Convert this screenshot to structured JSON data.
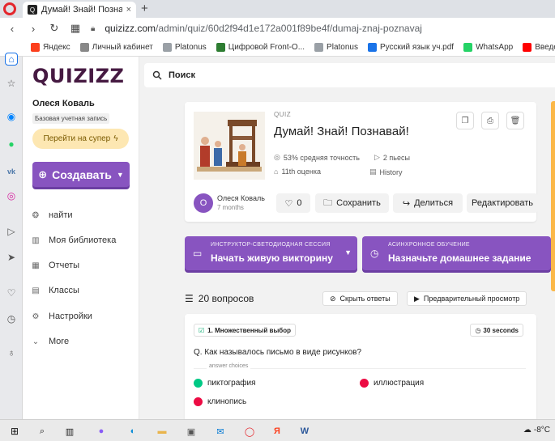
{
  "browser": {
    "tab_title": "Думай! Знай! Познавай! -",
    "tab_close": "×",
    "new_tab": "+",
    "url_host": "quizizz.com",
    "url_path": "/admin/quiz/60d2f94d1e172a001f89be4f/dumaj-znaj-poznavaj",
    "bookmarks": [
      {
        "label": "Яндекс",
        "color": "#fc3f1d"
      },
      {
        "label": "Личный кабинет",
        "color": "#888888"
      },
      {
        "label": "Platonus",
        "color": "#9aa0a6"
      },
      {
        "label": "Цифровой Front-O...",
        "color": "#2e7d32"
      },
      {
        "label": "Platonus",
        "color": "#9aa0a6"
      },
      {
        "label": "Русский язык уч.pdf",
        "color": "#1a73e8"
      },
      {
        "label": "WhatsApp",
        "color": "#25d366"
      },
      {
        "label": "Введение в языкоз...",
        "color": "#ff0000"
      }
    ]
  },
  "sidebar": {
    "logo": "QUIZIZZ",
    "user_name": "Олеся Коваль",
    "account_type": "Базовая учетная запись",
    "upgrade_label": "Перейти на супер",
    "create_label": "Создавать",
    "nav": [
      {
        "label": "найти",
        "icon": "compass-icon"
      },
      {
        "label": "Моя библиотека",
        "icon": "library-icon"
      },
      {
        "label": "Отчеты",
        "icon": "reports-icon"
      },
      {
        "label": "Классы",
        "icon": "classes-icon"
      },
      {
        "label": "Настройки",
        "icon": "settings-icon"
      },
      {
        "label": "More",
        "icon": "chevron-down-icon"
      }
    ]
  },
  "search": {
    "label": "Поиск"
  },
  "quiz": {
    "tag": "QUIZ",
    "title": "Думай! Знай! Познавай!",
    "accuracy": "53% средняя точность",
    "plays": "2 пьесы",
    "grade": "11th оценка",
    "subject": "History",
    "author": "Олеся Коваль",
    "author_initial": "О",
    "time_ago": "7 months",
    "likes": "0",
    "save_label": "Сохранить",
    "share_label": "Делиться",
    "edit_label": "Редактировать"
  },
  "actions": {
    "live_small": "ИНСТРУКТОР-СВЕТОДИОДНАЯ СЕССИЯ",
    "live_big": "Начать живую викторину",
    "hw_small": "АСИНХРОННОЕ ОБУЧЕНИЕ",
    "hw_big": "Назначьте домашнее задание"
  },
  "questions": {
    "count_label": "20 вопросов",
    "hide_answers": "Скрыть ответы",
    "preview": "Предварительный просмотр",
    "first": {
      "type": "1. Множественный выбор",
      "time": "30 seconds",
      "text": "Q. Как называлось письмо в виде рисунков?",
      "choices_label": "answer choices",
      "options": [
        {
          "label": "пиктография",
          "correct": true
        },
        {
          "label": "иллюстрация",
          "correct": false
        },
        {
          "label": "клинопись",
          "correct": false
        }
      ]
    }
  },
  "taskbar": {
    "weather": "-8°C"
  },
  "colors": {
    "brand_purple": "#8854c0",
    "logo_dark": "#461a42",
    "correct": "#00c985",
    "incorrect": "#ec0b43",
    "accent_orange": "#fbb848"
  }
}
